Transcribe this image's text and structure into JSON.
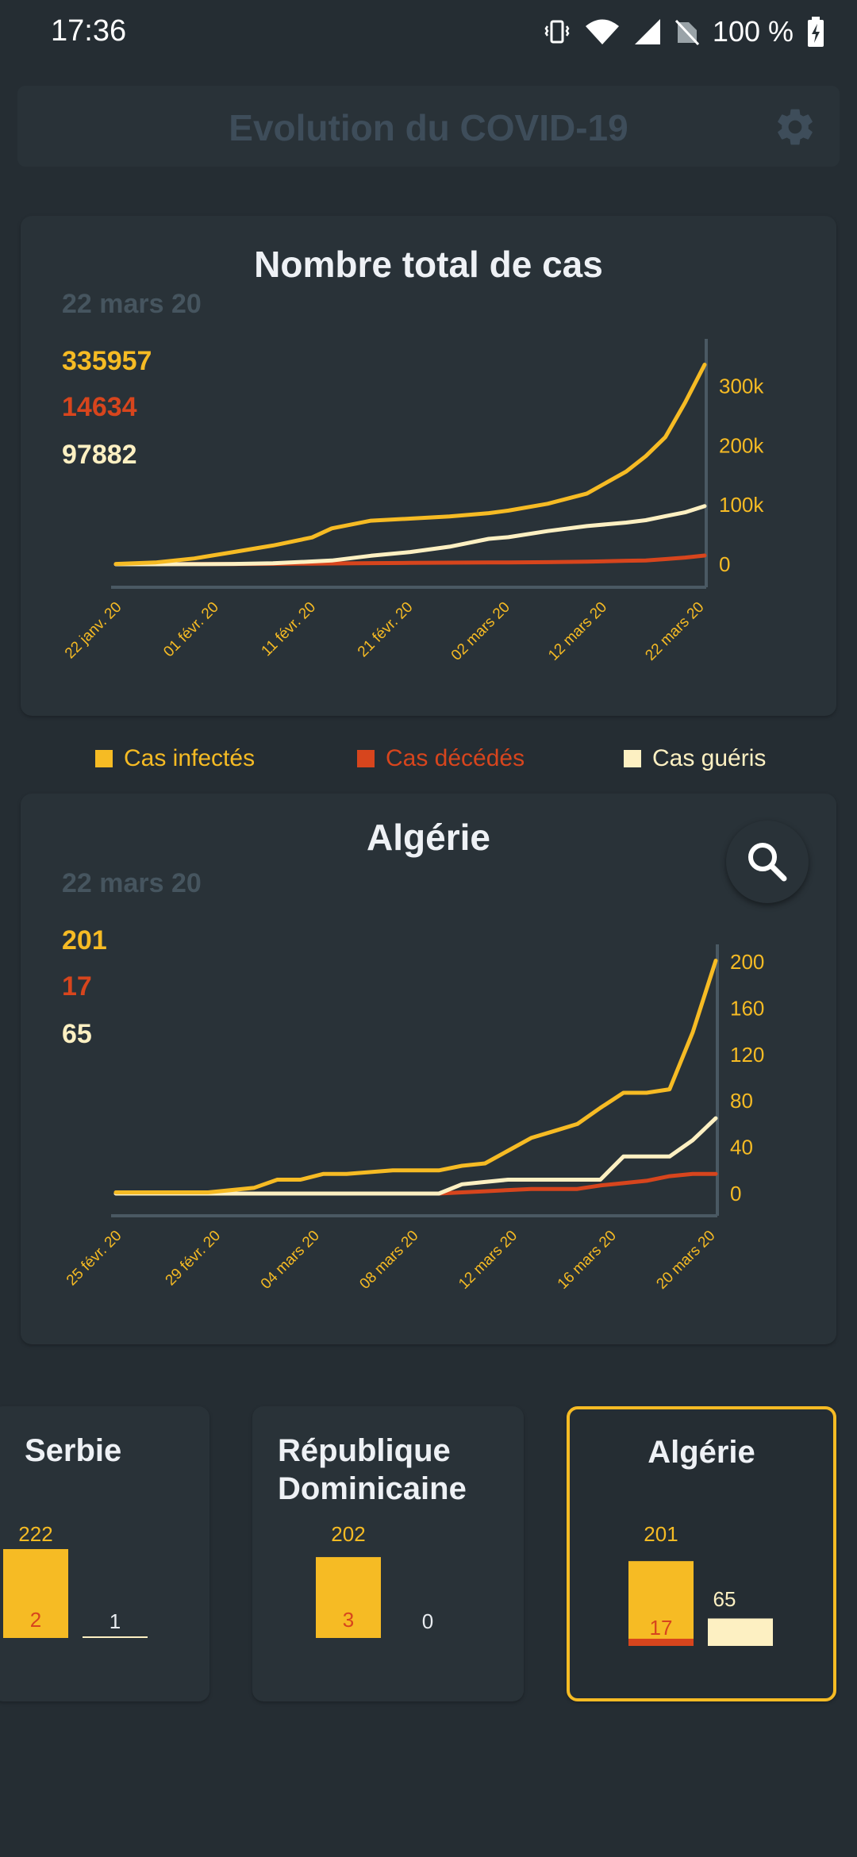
{
  "status_bar": {
    "time": "17:36",
    "battery": "100 %"
  },
  "app_bar": {
    "title": "Evolution du COVID-19",
    "settings_icon": "gear-icon"
  },
  "colors": {
    "infected": "#f6bb24",
    "deaths": "#d7451d",
    "recovered": "#fdf0c2",
    "background": "#252d33",
    "card": "#293238"
  },
  "world_card": {
    "title": "Nombre total de cas",
    "date": "22 mars 20",
    "infected": "335957",
    "deaths": "14634",
    "recovered": "97882"
  },
  "legend": {
    "infected": "Cas infectés",
    "deaths": "Cas décédés",
    "recovered": "Cas guéris"
  },
  "country_card": {
    "title": "Algérie",
    "date": "22 mars 20",
    "infected": "201",
    "deaths": "17",
    "recovered": "65",
    "search_icon": "search-icon"
  },
  "chart_data": [
    {
      "type": "line",
      "x_ticks": [
        "22 janv. 20",
        "01 févr. 20",
        "11 févr. 20",
        "21 févr. 20",
        "02 mars 20",
        "12 mars 20",
        "22 mars 20"
      ],
      "y_ticks": [
        "0",
        "100k",
        "200k",
        "300k"
      ],
      "ylim": [
        0,
        350000
      ],
      "x": [
        "2020-01-22",
        "2020-01-26",
        "2020-01-30",
        "2020-02-03",
        "2020-02-07",
        "2020-02-11",
        "2020-02-13",
        "2020-02-17",
        "2020-02-21",
        "2020-02-25",
        "2020-02-29",
        "2020-03-02",
        "2020-03-06",
        "2020-03-10",
        "2020-03-14",
        "2020-03-16",
        "2020-03-18",
        "2020-03-20",
        "2020-03-22"
      ],
      "series": [
        {
          "name": "Cas infectés",
          "values": [
            555,
            2900,
            9800,
            20600,
            31500,
            45200,
            60400,
            73300,
            76800,
            80400,
            86000,
            90300,
            101800,
            119000,
            156000,
            182000,
            214000,
            272000,
            335957
          ]
        },
        {
          "name": "Cas décédés",
          "values": [
            17,
            56,
            213,
            427,
            636,
            1017,
            1369,
            1873,
            2251,
            2708,
            2941,
            3085,
            3460,
            4262,
            5821,
            6440,
            8733,
            11200,
            14634
          ]
        },
        {
          "name": "Cas guéris",
          "values": [
            28,
            49,
            90,
            530,
            1580,
            4680,
            6220,
            14300,
            20600,
            29500,
            42700,
            45600,
            55900,
            64200,
            70200,
            74100,
            81000,
            87300,
            97882
          ]
        }
      ]
    },
    {
      "type": "line",
      "x_ticks": [
        "25 févr. 20",
        "29 févr. 20",
        "04 mars 20",
        "08 mars 20",
        "12 mars 20",
        "16 mars 20",
        "20 mars 20"
      ],
      "y_ticks": [
        "0",
        "40",
        "80",
        "120",
        "160",
        "200"
      ],
      "ylim": [
        0,
        200
      ],
      "x": [
        "2020-02-25",
        "2020-02-28",
        "2020-02-29",
        "2020-03-01",
        "2020-03-02",
        "2020-03-03",
        "2020-03-04",
        "2020-03-05",
        "2020-03-06",
        "2020-03-08",
        "2020-03-10",
        "2020-03-11",
        "2020-03-12",
        "2020-03-13",
        "2020-03-14",
        "2020-03-15",
        "2020-03-16",
        "2020-03-17",
        "2020-03-18",
        "2020-03-19",
        "2020-03-20",
        "2020-03-21",
        "2020-03-22"
      ],
      "series": [
        {
          "name": "Cas infectés",
          "values": [
            1,
            1,
            1,
            3,
            5,
            12,
            12,
            17,
            17,
            20,
            20,
            24,
            26,
            37,
            48,
            54,
            60,
            74,
            87,
            87,
            90,
            139,
            201
          ]
        },
        {
          "name": "Cas décédés",
          "values": [
            0,
            0,
            0,
            0,
            0,
            0,
            0,
            0,
            0,
            0,
            0,
            1,
            2,
            3,
            4,
            4,
            4,
            7,
            9,
            11,
            15,
            17,
            17
          ]
        },
        {
          "name": "Cas guéris",
          "values": [
            0,
            0,
            0,
            0,
            0,
            0,
            0,
            0,
            0,
            0,
            0,
            8,
            10,
            12,
            12,
            12,
            12,
            12,
            32,
            32,
            32,
            46,
            65
          ]
        }
      ]
    },
    {
      "type": "bar",
      "title": "Serbie",
      "values": {
        "infected": 222,
        "deaths": 2,
        "recovered": 1
      },
      "labels": [
        "222",
        "2",
        "1"
      ]
    },
    {
      "type": "bar",
      "title": "République Dominicaine",
      "values": {
        "infected": 202,
        "deaths": 3,
        "recovered": 0
      },
      "labels": [
        "202",
        "3",
        "0"
      ]
    },
    {
      "type": "bar",
      "title": "Algérie",
      "values": {
        "infected": 201,
        "deaths": 17,
        "recovered": 65
      },
      "labels": [
        "201",
        "17",
        "65"
      ]
    }
  ]
}
